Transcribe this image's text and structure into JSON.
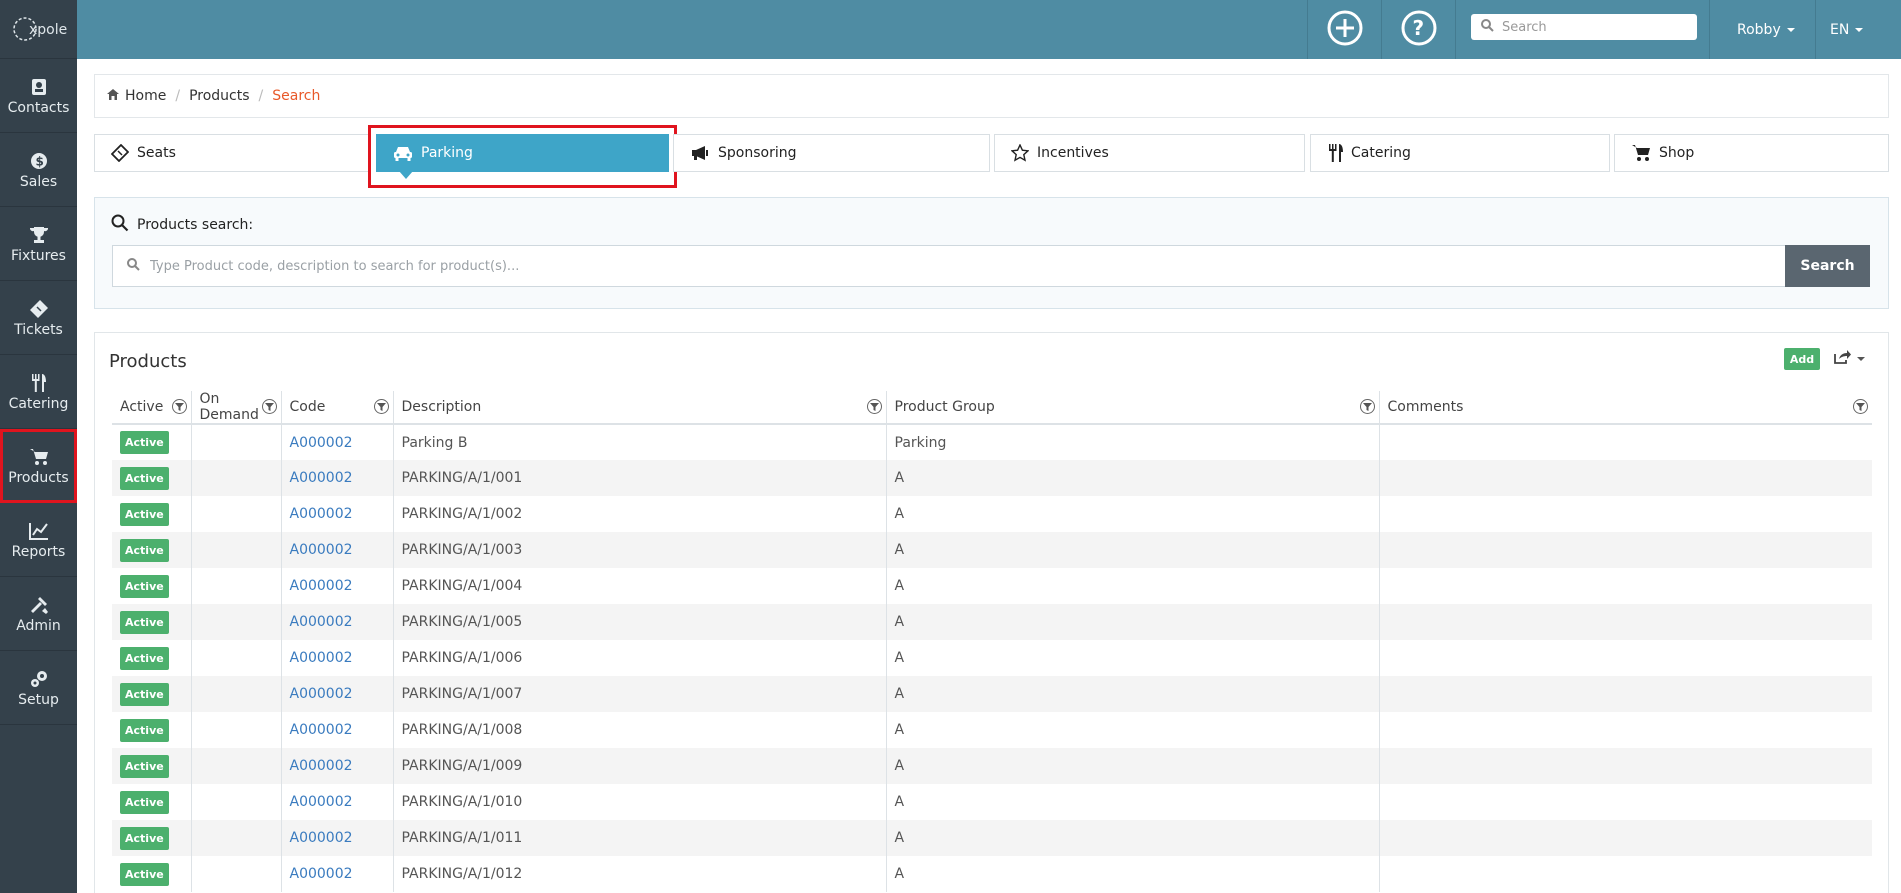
{
  "app": {
    "logo_text": "xpole"
  },
  "sidebar": {
    "items": [
      {
        "label": "Contacts",
        "icon": "contacts-icon"
      },
      {
        "label": "Sales",
        "icon": "dollar-icon"
      },
      {
        "label": "Fixtures",
        "icon": "trophy-icon"
      },
      {
        "label": "Tickets",
        "icon": "ticket-icon"
      },
      {
        "label": "Catering",
        "icon": "cutlery-icon"
      },
      {
        "label": "Products",
        "icon": "cart-icon"
      },
      {
        "label": "Reports",
        "icon": "chart-icon"
      },
      {
        "label": "Admin",
        "icon": "tools-icon"
      },
      {
        "label": "Setup",
        "icon": "gears-icon"
      }
    ]
  },
  "topbar": {
    "search_placeholder": "Search",
    "user": "Robby",
    "lang": "EN"
  },
  "breadcrumb": {
    "home": "Home",
    "products": "Products",
    "current": "Search"
  },
  "categories": [
    "Seats",
    "Parking",
    "Sponsoring",
    "Incentives",
    "Catering",
    "Shop"
  ],
  "search": {
    "title": "Products search:",
    "placeholder": "Type Product code, description to search for product(s)...",
    "button": "Search"
  },
  "products": {
    "title": "Products",
    "add_label": "Add",
    "columns": [
      "Active",
      "On Demand",
      "Code",
      "Description",
      "Product Group",
      "Comments"
    ],
    "rows": [
      {
        "active": "Active",
        "on_demand": "",
        "code": "A000002",
        "description": "Parking B",
        "group": "Parking",
        "comments": ""
      },
      {
        "active": "Active",
        "on_demand": "",
        "code": "A000002",
        "description": "PARKING/A/1/001",
        "group": "A",
        "comments": ""
      },
      {
        "active": "Active",
        "on_demand": "",
        "code": "A000002",
        "description": "PARKING/A/1/002",
        "group": "A",
        "comments": ""
      },
      {
        "active": "Active",
        "on_demand": "",
        "code": "A000002",
        "description": "PARKING/A/1/003",
        "group": "A",
        "comments": ""
      },
      {
        "active": "Active",
        "on_demand": "",
        "code": "A000002",
        "description": "PARKING/A/1/004",
        "group": "A",
        "comments": ""
      },
      {
        "active": "Active",
        "on_demand": "",
        "code": "A000002",
        "description": "PARKING/A/1/005",
        "group": "A",
        "comments": ""
      },
      {
        "active": "Active",
        "on_demand": "",
        "code": "A000002",
        "description": "PARKING/A/1/006",
        "group": "A",
        "comments": ""
      },
      {
        "active": "Active",
        "on_demand": "",
        "code": "A000002",
        "description": "PARKING/A/1/007",
        "group": "A",
        "comments": ""
      },
      {
        "active": "Active",
        "on_demand": "",
        "code": "A000002",
        "description": "PARKING/A/1/008",
        "group": "A",
        "comments": ""
      },
      {
        "active": "Active",
        "on_demand": "",
        "code": "A000002",
        "description": "PARKING/A/1/009",
        "group": "A",
        "comments": ""
      },
      {
        "active": "Active",
        "on_demand": "",
        "code": "A000002",
        "description": "PARKING/A/1/010",
        "group": "A",
        "comments": ""
      },
      {
        "active": "Active",
        "on_demand": "",
        "code": "A000002",
        "description": "PARKING/A/1/011",
        "group": "A",
        "comments": ""
      },
      {
        "active": "Active",
        "on_demand": "",
        "code": "A000002",
        "description": "PARKING/A/1/012",
        "group": "A",
        "comments": ""
      }
    ]
  },
  "colors": {
    "topbar": "#4f8ca3",
    "sidebar": "#34414b",
    "accent": "#3ea5c8",
    "active_badge": "#4cb06d",
    "highlight": "#e0141e"
  }
}
